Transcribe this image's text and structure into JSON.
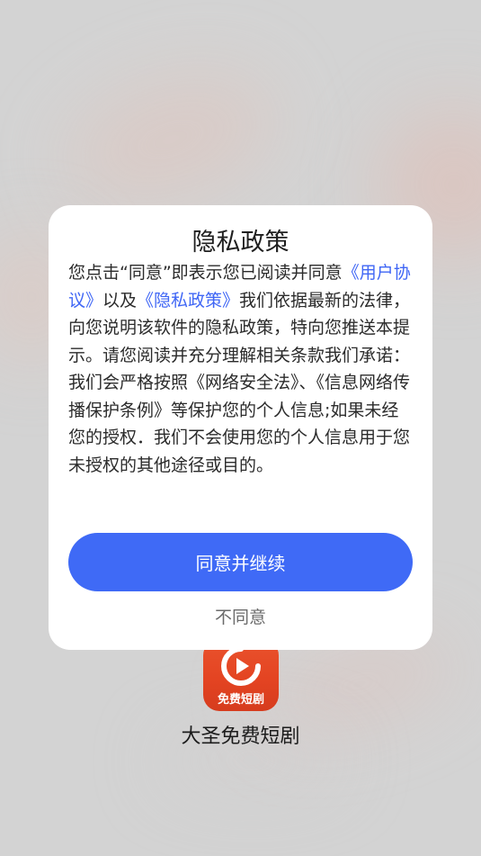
{
  "dialog": {
    "title": "隐私政策",
    "body": {
      "intro_prefix": "您点击“同意”即表示您已阅读并同意",
      "user_agreement_link": "《用户协议》",
      "connector": "以及",
      "privacy_policy_link": "《隐私政策》",
      "intro_suffix": "我们依据最新的法律，向您说明该软件的隐私政策，特向您推送本提示。请您阅读并充分理解相关条款我们承诺：",
      "commitment": "我们会严格按照《网络安全法》、《信息网络传播保护条例》等保护您的个人信息;如果未经您的授权．我们不会使用您的个人信息用于您未授权的其他途径或目的。"
    },
    "agree_label": "同意并继续",
    "disagree_label": "不同意"
  },
  "app": {
    "logo_tag": "免费短剧",
    "name": "大圣免费短剧"
  },
  "colors": {
    "accent": "#3f6af6",
    "link": "#3f66f5",
    "logo_red": "#e44422",
    "background": "#d3d3d3"
  },
  "icons": {
    "logo_icon": "play-icon"
  }
}
